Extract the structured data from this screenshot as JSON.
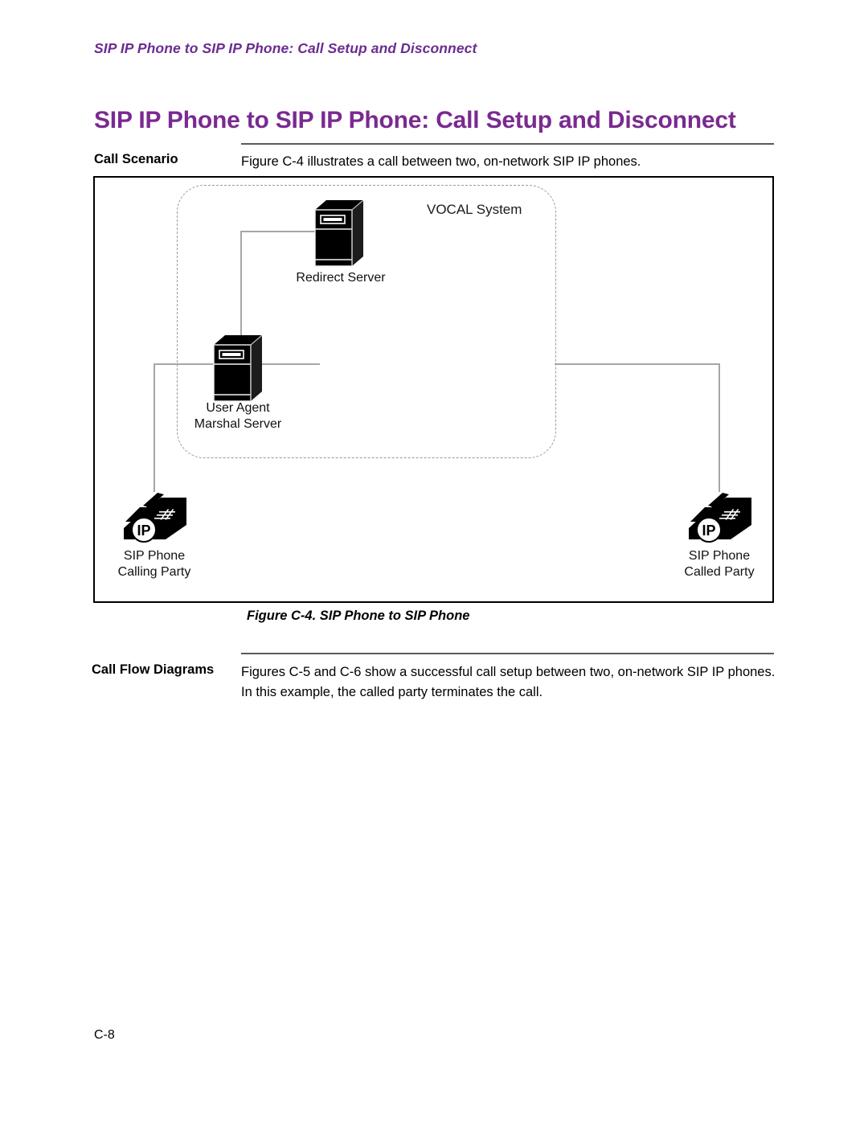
{
  "page": {
    "running_header": "SIP IP Phone to SIP IP Phone: Call Setup and Disconnect",
    "chapter_title": "SIP IP Phone to SIP IP Phone: Call Setup and Disconnect",
    "page_number": "C-8"
  },
  "sections": {
    "call_scenario": {
      "label": "Call Scenario",
      "text": "Figure C-4 illustrates a call between two, on-network SIP IP phones."
    },
    "call_flow_diagrams": {
      "label": "Call Flow Diagrams",
      "text": "Figures C-5 and C-6 show a successful call setup between two, on-network SIP IP phones. In this example, the called party terminates the call."
    }
  },
  "figure": {
    "caption": "Figure C-4. SIP Phone to SIP Phone",
    "boundary_label": "VOCAL System",
    "nodes": [
      {
        "id": "redirect-server",
        "type": "server",
        "label": "Redirect Server"
      },
      {
        "id": "ua-marshal-server",
        "type": "server",
        "label_line1": "User Agent",
        "label_line2": "Marshal Server"
      },
      {
        "id": "sip-phone-calling",
        "type": "ip-phone",
        "badge": "IP",
        "label_line1": "SIP Phone",
        "label_line2": "Calling Party"
      },
      {
        "id": "sip-phone-called",
        "type": "ip-phone",
        "badge": "IP",
        "label_line1": "SIP Phone",
        "label_line2": "Called Party"
      }
    ]
  },
  "colors": {
    "heading_purple": "#7A2A90",
    "header_purple": "#6B2D91",
    "rule_gray": "#5a5a5a",
    "connector_gray": "#a6a6a6",
    "boundary_gray": "#9a9a9a",
    "icon_black": "#000000"
  }
}
